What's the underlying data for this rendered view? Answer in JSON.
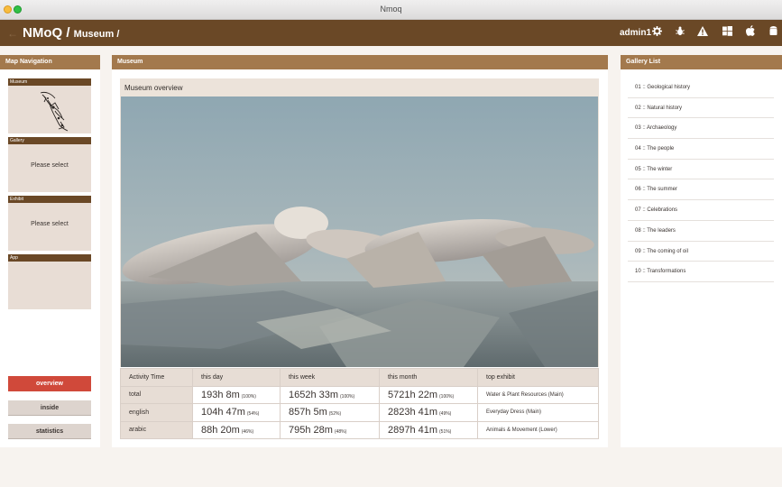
{
  "window": {
    "title": "Nmoq"
  },
  "header": {
    "brand": "NMoQ /",
    "breadcrumb": "Museum /",
    "user": "admin1",
    "icons": [
      "settings-icon",
      "bug-icon",
      "warning-icon",
      "windows-icon",
      "apple-icon",
      "android-icon"
    ]
  },
  "left": {
    "title": "Map Navigation",
    "sections": [
      {
        "label": "Museum",
        "value": ""
      },
      {
        "label": "Gallery",
        "value": "Please select"
      },
      {
        "label": "Exhibit",
        "value": "Please select"
      },
      {
        "label": "App",
        "value": ""
      }
    ],
    "buttons": [
      "overview",
      "inside",
      "statistics"
    ]
  },
  "center": {
    "title": "Museum",
    "overview_label": "Museum overview",
    "table": {
      "headers": [
        "Activity Time",
        "this day",
        "this week",
        "this month",
        "top exhibit"
      ],
      "rows": [
        {
          "label": "total",
          "day": "193h 8m",
          "day_pct": "(100%)",
          "week": "1652h 33m",
          "week_pct": "(100%)",
          "month": "5721h 22m",
          "month_pct": "(100%)",
          "top": "Water & Plant Resources (Main)"
        },
        {
          "label": "english",
          "day": "104h 47m",
          "day_pct": "(54%)",
          "week": "857h 5m",
          "week_pct": "(52%)",
          "month": "2823h 41m",
          "month_pct": "(49%)",
          "top": "Everyday Dress (Main)"
        },
        {
          "label": "arabic",
          "day": "88h 20m",
          "day_pct": "(46%)",
          "week": "795h 28m",
          "week_pct": "(48%)",
          "month": "2897h 41m",
          "month_pct": "(51%)",
          "top": "Animals & Movement (Lower)"
        }
      ]
    }
  },
  "right": {
    "title": "Gallery List",
    "items": [
      "01 :: Geological history",
      "02 :: Natural history",
      "03 :: Archaeology",
      "04 :: The people",
      "05 :: The winter",
      "06 :: The summer",
      "07 :: Celebrations",
      "08 :: The leaders",
      "09 :: The coming of oil",
      "10 :: Transformations"
    ]
  },
  "colors": {
    "header": "#6a4826",
    "panel_head": "#a3794d",
    "active_button": "#d0493a"
  }
}
